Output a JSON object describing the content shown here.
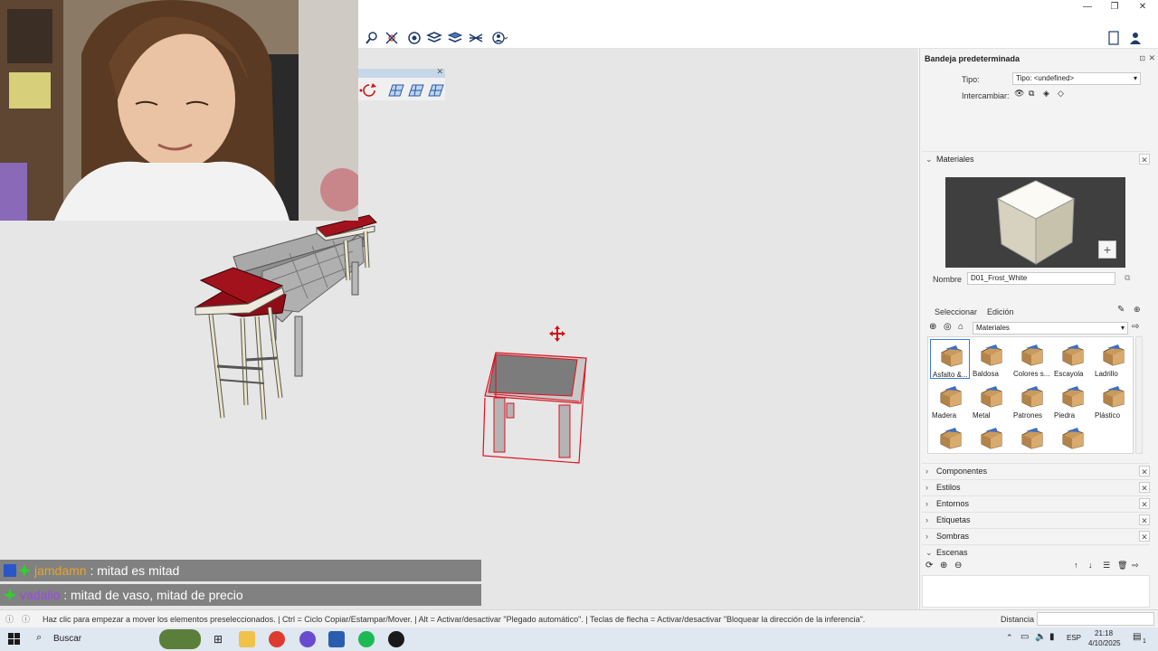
{
  "window": {
    "minimize_glyph": "—",
    "restore_glyph": "❐",
    "close_glyph": "✕"
  },
  "toolbar": {
    "icons": [
      "zoom-icon",
      "zoom-extents-icon",
      "orbit-icon",
      "section-plane-icon",
      "section-fill-icon",
      "section-cut-icon",
      "account-icon"
    ],
    "new_doc_icon": "document-icon",
    "profile_icon": "user-icon"
  },
  "chat": [
    {
      "user": "jamdamn",
      "sep": " : ",
      "message": "mitad es mitad"
    },
    {
      "user": "vadalio",
      "sep": " : ",
      "message": "mitad de vaso, mitad de precio"
    }
  ],
  "tray": {
    "title": "Bandeja predeterminada",
    "tipo_label": "Tipo:",
    "tipo_value": "Tipo: <undefined>",
    "intercambiar_label": "Intercambiar:",
    "materials": {
      "header": "Materiales",
      "nombre_label": "Nombre",
      "nombre_value": "D01_Frost_White",
      "tabs": [
        "Seleccionar",
        "Edición"
      ],
      "library_value": "Materiales",
      "items": [
        {
          "label": "Asfalto &..."
        },
        {
          "label": "Baldosa"
        },
        {
          "label": "Colores s..."
        },
        {
          "label": "Escayola"
        },
        {
          "label": "Ladrillo"
        },
        {
          "label": "Madera"
        },
        {
          "label": "Metal"
        },
        {
          "label": "Patrones"
        },
        {
          "label": "Piedra"
        },
        {
          "label": "Plástico"
        },
        {
          "label": ""
        },
        {
          "label": ""
        },
        {
          "label": ""
        },
        {
          "label": ""
        }
      ]
    },
    "sections": [
      "Componentes",
      "Estilos",
      "Entornos",
      "Etiquetas",
      "Sombras",
      "Escenas"
    ]
  },
  "statusbar": {
    "hint": "Haz clic para empezar a mover los elementos preseleccionados. | Ctrl = Ciclo Copiar/Estampar/Mover. | Alt = Activar/desactivar \"Plegado automático\". | Teclas de flecha = Activar/desactivar \"Bloquear la dirección de la inferencia\".",
    "measure_label": "Distancia",
    "measure_value": ""
  },
  "taskbar": {
    "search_label": "Buscar",
    "lang": "ESP",
    "time": "21:18",
    "date": "4/10/2025",
    "notif_count": "1"
  },
  "colors": {
    "accent": "#1e3b6e",
    "selection_red": "#e0101e",
    "viewport_bg": "#e6e6e6",
    "cushion": "#8e0d16"
  }
}
